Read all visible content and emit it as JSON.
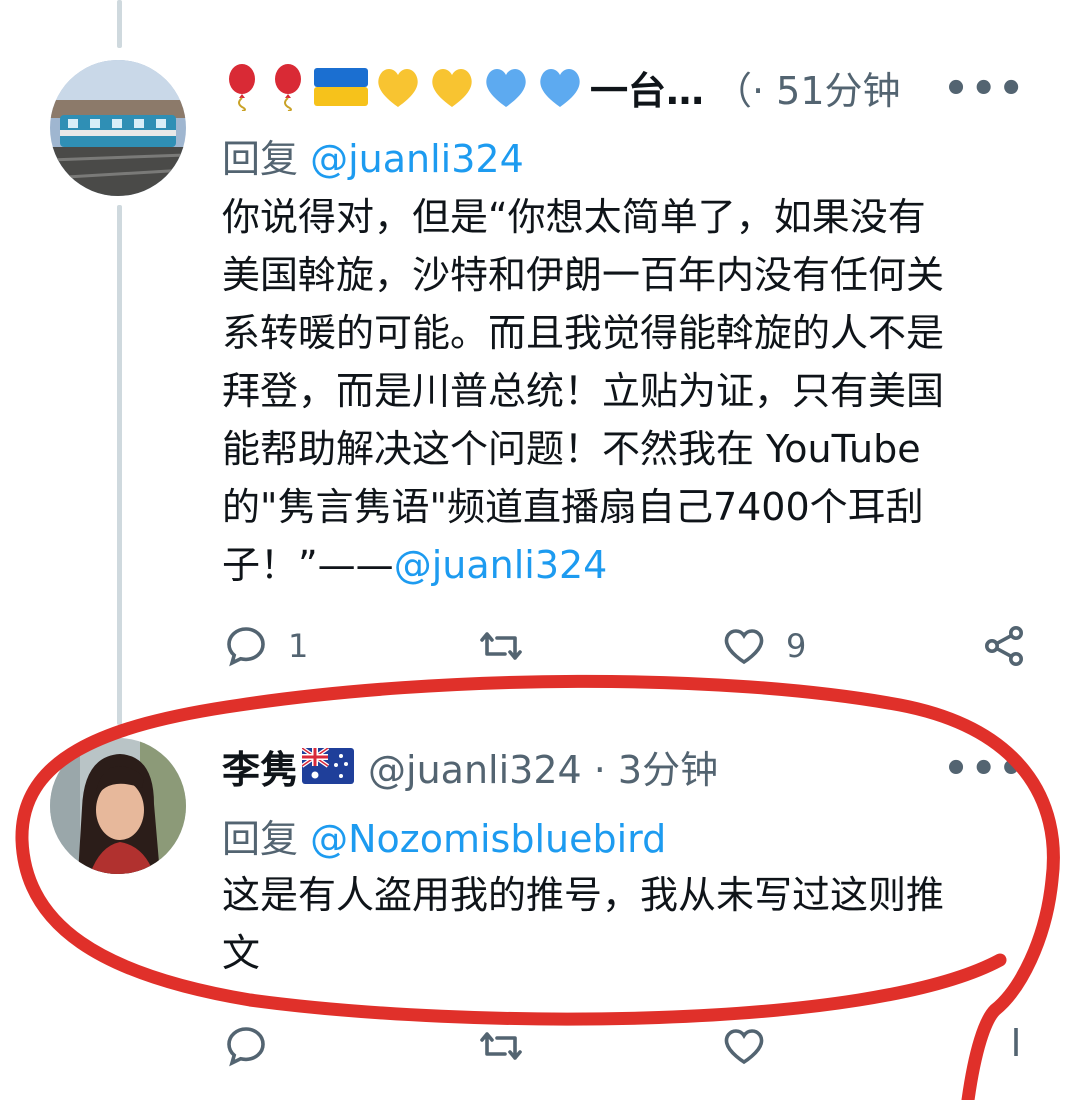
{
  "tweets": [
    {
      "display_name_suffix": "一台…",
      "handle_and_time": "（· 51分钟",
      "reply_label": "回复",
      "reply_mention": "@juanli324",
      "body": "你说得对，但是“你想太简单了，如果没有\n美国斡旋，沙特和伊朗一百年内没有任何关\n系转暖的可能。而且我觉得能斡旋的人不是\n拜登，而是川普总统！立贴为证，只有美国\n能帮助解决这个问题！不然我在 YouTube\n的\"隽言隽语\"频道直播扇自己7400个耳刮\n子！”——",
      "body_mention": "@juanli324",
      "reply_count": "1",
      "like_count": "9",
      "name_icons": [
        "red-balloon",
        "red-balloon",
        "ukraine-flag",
        "yellow-heart",
        "yellow-heart",
        "blue-heart",
        "blue-heart"
      ]
    },
    {
      "display_name": "李隽",
      "flag": "australia-flag",
      "handle_and_time": "@juanli324 · 3分钟",
      "reply_label": "回复",
      "reply_mention": "@Nozomisbluebird",
      "body": "这是有人盗用我的推号，我从未写过这则推\n文"
    }
  ],
  "colors": {
    "text": "#0f1419",
    "secondary": "#536471",
    "link": "#1d9bf0",
    "highlight_circle": "#e0302a"
  }
}
